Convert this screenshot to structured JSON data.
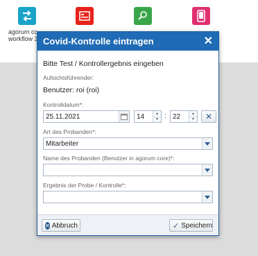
{
  "desktop": {
    "apps": [
      {
        "label_line1": "agorum co",
        "label_line2": "workflow 3",
        "icon": "workflow-icon",
        "color": "#1aa3c9"
      },
      {
        "label_line1": "",
        "label_line2": "",
        "icon": "presentation-icon",
        "color": "#e8231c"
      },
      {
        "label_line1": "",
        "label_line2": "",
        "icon": "search-document-icon",
        "color": "#3aa64a"
      },
      {
        "label_line1": "",
        "label_line2": "",
        "icon": "mobile-icon",
        "color": "#e0306f"
      }
    ]
  },
  "dialog": {
    "title": "Covid-Kontrolle eintragen",
    "subtitle": "Bitte Test / Kontrollergebnis eingeben",
    "supervisor_label": "Aufsichtsführender:",
    "supervisor_value": "Benutzer: roi (roi)",
    "date_label": "Kontrolldatum*:",
    "date_value": "25.11.2021",
    "hour_value": "14",
    "time_separator": ":",
    "minute_value": "22",
    "proband_type_label": "Art des Probanden*:",
    "proband_type_value": "Mitarbeiter",
    "proband_name_label": "Name des Probanden (Benutzer in agorum core)*:",
    "proband_name_value": "",
    "result_label": "Ergebnis der Probe / Kontrolle*:",
    "result_value": "",
    "cancel_label": "Abbruch",
    "save_label": "Speichern"
  },
  "colors": {
    "header": "#1f6bb5",
    "page_bg": "#dcdcdc"
  }
}
